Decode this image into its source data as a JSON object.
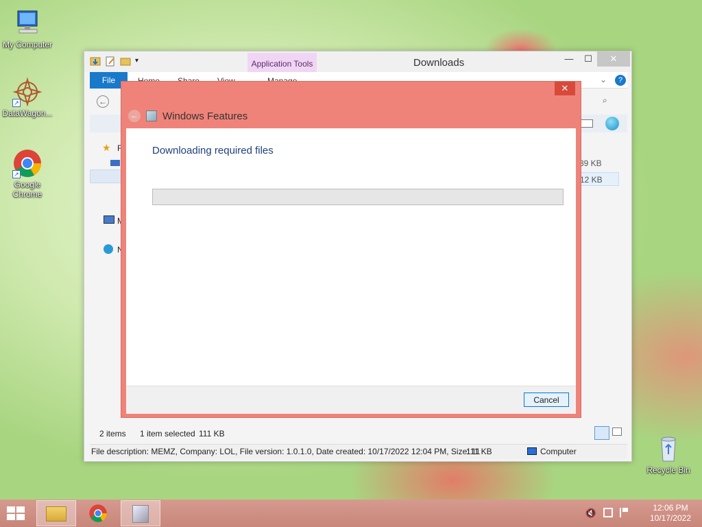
{
  "desktop": {
    "icons": [
      {
        "label": "My Computer",
        "icon": "computer-icon"
      },
      {
        "label": "DataWagon...",
        "icon": "datawagon-icon"
      },
      {
        "label": "Google Chrome",
        "icon": "chrome-icon"
      },
      {
        "label": "Recycle Bin",
        "icon": "recycle-bin-icon"
      }
    ]
  },
  "explorer": {
    "title": "Downloads",
    "contextual_tab": "Application Tools",
    "ribbon_tabs": {
      "file": "File",
      "home": "Home",
      "share": "Share",
      "view": "View",
      "manage": "Manage"
    },
    "nav_partial": [
      "F",
      "M",
      "N"
    ],
    "file_sizes_partial": [
      "39 KB",
      "12 KB"
    ],
    "status": {
      "items": "2 items",
      "selected": "1 item selected",
      "size": "111 KB"
    },
    "details": {
      "description": "File description: MEMZ, Company: LOL, File version: 1.0.1.0, Date created: 10/17/2022 12:04 PM, Size: 11",
      "size": "111 KB",
      "location": "Computer"
    }
  },
  "dialog": {
    "title": "Windows Features",
    "heading": "Downloading required files",
    "progress": 0,
    "cancel_label": "Cancel",
    "close_glyph": "✕"
  },
  "taskbar": {
    "apps": [
      "file-explorer-icon",
      "chrome-icon",
      "installer-icon"
    ],
    "tray": [
      "volume-muted-icon",
      "network-icon",
      "action-center-icon"
    ],
    "time": "12:06 PM",
    "date": "10/17/2022"
  },
  "colors": {
    "dialog_frame": "#f08379",
    "accent": "#1979ca",
    "progress_fill": "#06b025"
  }
}
